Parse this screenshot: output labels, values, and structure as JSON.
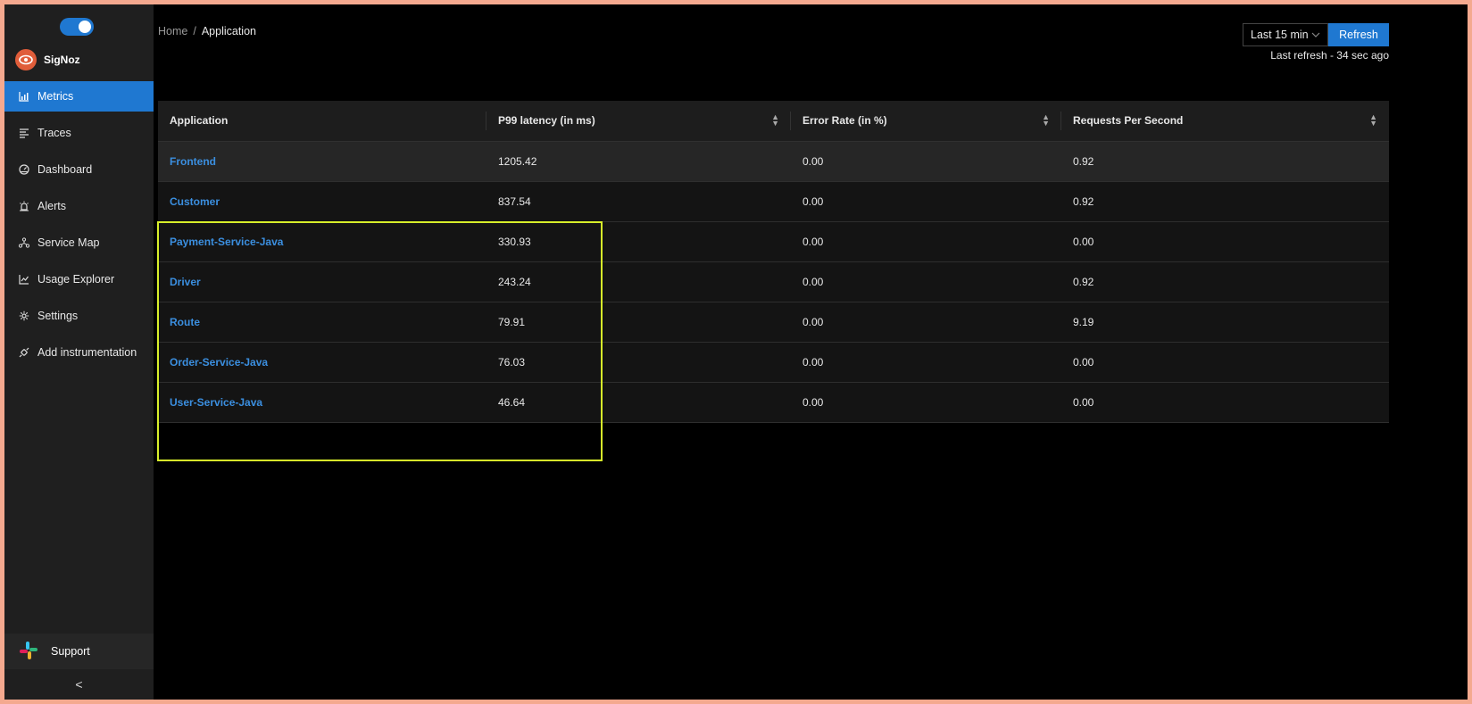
{
  "sidebar": {
    "brand": "SigNoz",
    "items": [
      {
        "label": "Metrics",
        "icon": "bar-chart-icon"
      },
      {
        "label": "Traces",
        "icon": "list-icon"
      },
      {
        "label": "Dashboard",
        "icon": "dashboard-icon"
      },
      {
        "label": "Alerts",
        "icon": "alert-icon"
      },
      {
        "label": "Service Map",
        "icon": "deployment-unit-icon"
      },
      {
        "label": "Usage Explorer",
        "icon": "line-chart-icon"
      },
      {
        "label": "Settings",
        "icon": "gear-icon"
      },
      {
        "label": "Add instrumentation",
        "icon": "api-icon"
      }
    ],
    "active": "Metrics",
    "support_label": "Support",
    "collapse_glyph": "<"
  },
  "breadcrumb": {
    "home": "Home",
    "separator": "/",
    "current": "Application"
  },
  "header": {
    "time_range": "Last 15 min",
    "refresh_label": "Refresh",
    "last_refresh": "Last refresh - 34 sec ago"
  },
  "table": {
    "columns": [
      "Application",
      "P99 latency (in ms)",
      "Error Rate (in %)",
      "Requests Per Second"
    ],
    "rows": [
      {
        "app": "Frontend",
        "p99": "1205.42",
        "error_rate": "0.00",
        "rps": "0.92"
      },
      {
        "app": "Customer",
        "p99": "837.54",
        "error_rate": "0.00",
        "rps": "0.92"
      },
      {
        "app": "Payment-Service-Java",
        "p99": "330.93",
        "error_rate": "0.00",
        "rps": "0.00"
      },
      {
        "app": "Driver",
        "p99": "243.24",
        "error_rate": "0.00",
        "rps": "0.92"
      },
      {
        "app": "Route",
        "p99": "79.91",
        "error_rate": "0.00",
        "rps": "9.19"
      },
      {
        "app": "Order-Service-Java",
        "p99": "76.03",
        "error_rate": "0.00",
        "rps": "0.00"
      },
      {
        "app": "User-Service-Java",
        "p99": "46.64",
        "error_rate": "0.00",
        "rps": "0.00"
      }
    ]
  },
  "colors": {
    "accent": "#1f78d1",
    "link": "#3b8fe0",
    "highlight_box": "#d7ee2a",
    "brand_logo": "#e05d3a"
  }
}
